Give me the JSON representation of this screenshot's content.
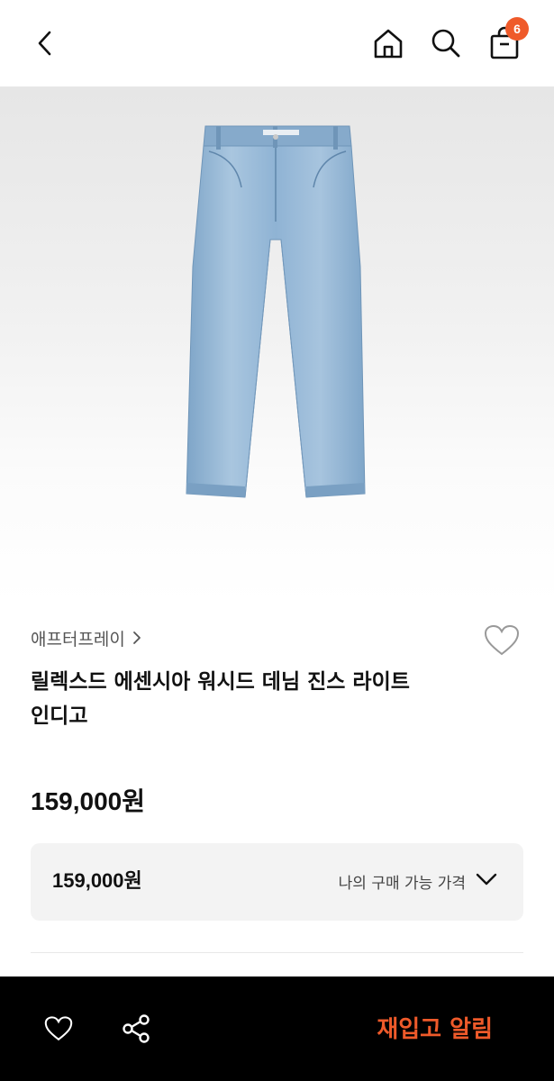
{
  "header": {
    "cart_count": "6"
  },
  "icons": {
    "back": "chevron-left-icon",
    "home": "home-icon",
    "search": "search-icon",
    "cart": "shopping-bag-icon",
    "wishlist": "heart-icon",
    "share": "share-icon"
  },
  "product": {
    "brand": "애프터프레이",
    "title_line1": "릴렉스드 에센시아 워시드 데님 진스 라이트",
    "title_line2": "인디고",
    "price": "159,000원",
    "my_price": "159,000원",
    "my_price_label": "나의 구매 가능 가격"
  },
  "bottom_bar": {
    "restock_alert": "재입고 알림"
  },
  "colors": {
    "accent": "#ef5a2a",
    "bottom_bar_bg": "#000000",
    "price_box_bg": "#f3f3f3"
  }
}
